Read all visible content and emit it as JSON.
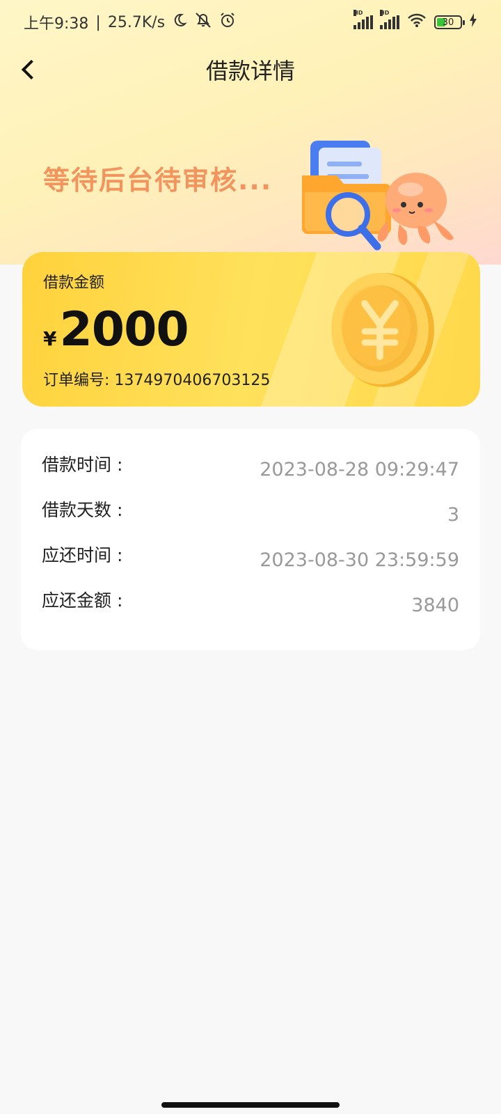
{
  "status_bar": {
    "time": "上午9:38",
    "separator": "|",
    "speed": "25.7K/s",
    "hd1": "HD",
    "hd2": "HD",
    "battery_level": "30",
    "icons": [
      "moon-icon",
      "bell-off-icon",
      "alarm-icon",
      "signal-icon",
      "signal-icon",
      "wifi-icon",
      "battery-icon",
      "charging-icon"
    ]
  },
  "nav": {
    "title": "借款详情"
  },
  "banner": {
    "status_text": "等待后台待审核..."
  },
  "amount_card": {
    "label": "借款金额",
    "currency": "¥",
    "amount": "2000",
    "order_label": "订单编号:",
    "order_no": "1374970406703125"
  },
  "details": {
    "rows": [
      {
        "label": "借款时间 :",
        "value": "2023-08-28 09:29:47"
      },
      {
        "label": "借款天数 :",
        "value": "3"
      },
      {
        "label": "应还时间 :",
        "value": "2023-08-30 23:59:59"
      },
      {
        "label": "应还金额 :",
        "value": "3840"
      }
    ]
  },
  "colors": {
    "banner_text": "#f2945e",
    "card_yellow": "#ffd84a",
    "value_grey": "#999999"
  }
}
